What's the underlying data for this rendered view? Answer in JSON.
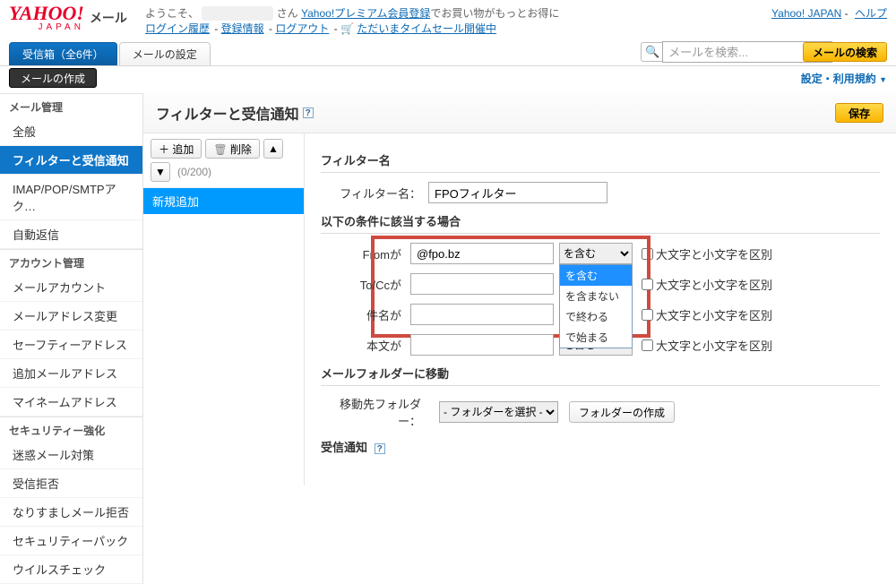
{
  "header": {
    "logo": {
      "main": "YAHOO!",
      "sub": "JAPAN"
    },
    "brand_title": "メール",
    "greeting_prefix": "ようこそ、",
    "greeting_suffix": "さん",
    "premium_link": "Yahoo!プレミアム会員登録",
    "premium_tail": "でお買い物がもっとお得に",
    "links": {
      "login_history": "ログイン履歴",
      "reg_info": "登録情報",
      "logout": "ログアウト",
      "sale": "ただいまタイムセール開催中"
    },
    "top_right": {
      "yj": "Yahoo! JAPAN",
      "help": "ヘルプ"
    }
  },
  "tabs": {
    "inbox": "受信箱（全6件）",
    "settings": "メールの設定"
  },
  "search": {
    "placeholder": "メールを検索...",
    "button": "メールの検索"
  },
  "compose": "メールの作成",
  "settings_terms": "設定・利用規約",
  "sidebar": {
    "groups": [
      {
        "title": "メール管理",
        "items": [
          "全般",
          "フィルターと受信通知",
          "IMAP/POP/SMTPアク…",
          "自動返信"
        ]
      },
      {
        "title": "アカウント管理",
        "items": [
          "メールアカウント",
          "メールアドレス変更",
          "セーフティーアドレス",
          "追加メールアドレス",
          "マイネームアドレス"
        ]
      },
      {
        "title": "セキュリティー強化",
        "items": [
          "迷惑メール対策",
          "受信拒否",
          "なりすましメール拒否",
          "セキュリティーパック",
          "ウイルスチェック"
        ]
      }
    ]
  },
  "page": {
    "title": "フィルターと受信通知",
    "save": "保存"
  },
  "toolbar": {
    "add": "＋ 追加",
    "delete": "削除",
    "count": "(0/200)"
  },
  "filter_list": {
    "item0": "新規追加"
  },
  "form": {
    "section_name": "フィルター名",
    "name_label": "フィルター名：",
    "name_value": "FPOフィルター",
    "section_cond": "以下の条件に該当する場合",
    "from_label": "Fromが",
    "from_value": "@fpo.bz",
    "tocc_label": "To/Ccが",
    "subject_label": "件名が",
    "body_label": "本文が",
    "match_selected": "を含む",
    "match_options": [
      "を含む",
      "を含まない",
      "で終わる",
      "で始まる"
    ],
    "case_label": "大文字と小文字を区別",
    "section_move": "メールフォルダーに移動",
    "move_label": "移動先フォルダー：",
    "folder_placeholder": "- フォルダーを選択 -",
    "folder_create": "フォルダーの作成",
    "section_notify": "受信通知"
  }
}
